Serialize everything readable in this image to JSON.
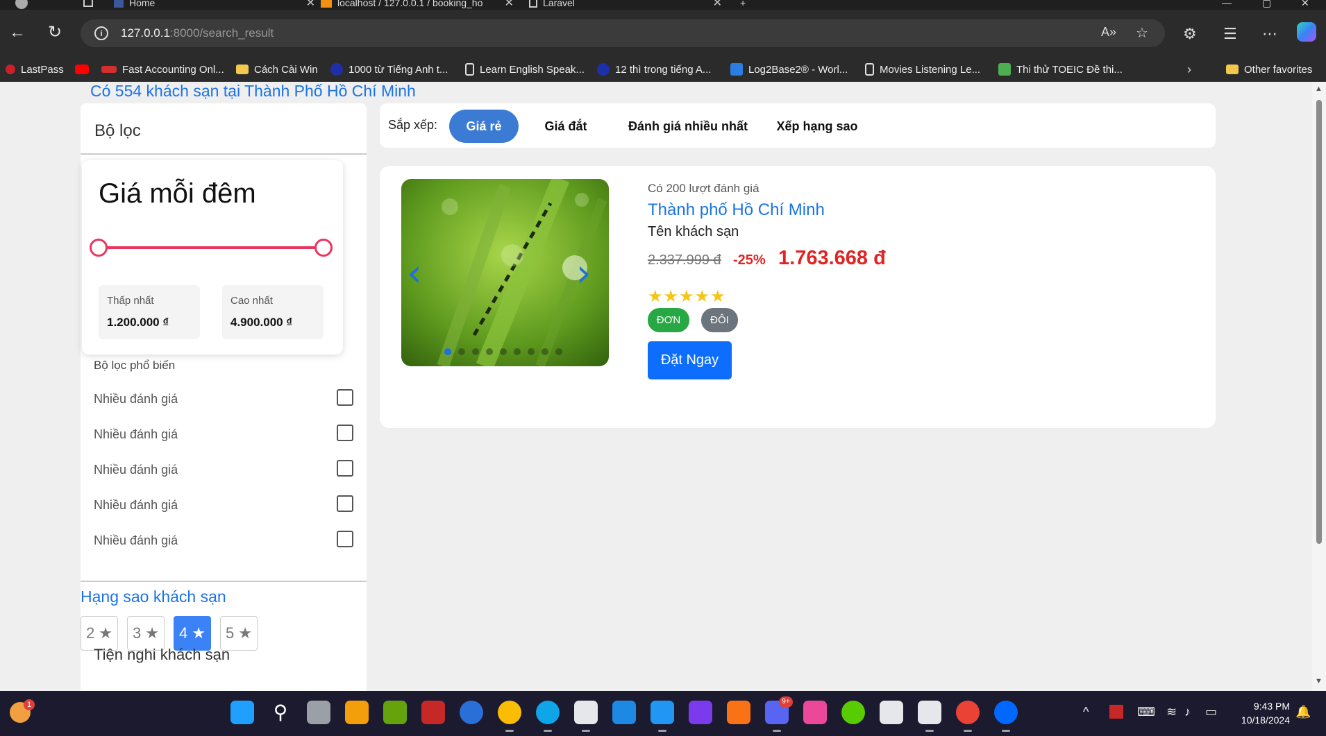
{
  "tabs": [
    {
      "label": "Home"
    },
    {
      "label": "localhost / 127.0.0.1 / booking_ho"
    },
    {
      "label": "Laravel"
    }
  ],
  "browser": {
    "url_host": "127.0.0.1",
    "url_rest": ":8000/search_result"
  },
  "bookmarks": [
    {
      "label": "LastPass",
      "icon": "lastpass-icon",
      "color": "#cc2029"
    },
    {
      "label": "",
      "icon": "youtube-icon",
      "color": "#ff0000"
    },
    {
      "label": "Fast Accounting Onl...",
      "icon": "fast-icon",
      "color": "#d32f2f"
    },
    {
      "label": "Cách Cài Win",
      "icon": "folder-icon",
      "color": "#f2c94c"
    },
    {
      "label": "1000 từ Tiếng Anh t...",
      "icon": "globe-icon",
      "color": "#1e2fa8"
    },
    {
      "label": "Learn English Speak...",
      "icon": "page-icon",
      "color": "#e0e0e0"
    },
    {
      "label": "12 thì trong tiếng A...",
      "icon": "globe-icon",
      "color": "#1e2fa8"
    },
    {
      "label": "Log2Base2® - Worl...",
      "icon": "log2base2-icon",
      "color": "#2a7de1"
    },
    {
      "label": "Movies Listening Le...",
      "icon": "page-icon",
      "color": "#e0e0e0"
    },
    {
      "label": "Thi thử TOEIC Đề thi...",
      "icon": "toeic-icon",
      "color": "#4caf50"
    }
  ],
  "other_favorites": "Other favorites",
  "page": {
    "result_title": "Có 554 khách sạn tại Thành Phố Hồ Chí Minh",
    "filter_title": "Bộ lọc",
    "price": {
      "title": "Giá mỗi đêm",
      "min_label": "Thấp nhất",
      "min_value": "1.200.000 ₫",
      "max_label": "Cao nhất",
      "max_value": "4.900.000 ₫",
      "slider_min_fraction": 0,
      "slider_max_fraction": 1
    },
    "popular_label": "Bộ lọc phổ biến",
    "popular_filters": [
      {
        "label": "Nhiều đánh giá",
        "checked": false
      },
      {
        "label": "Nhiều đánh giá",
        "checked": false
      },
      {
        "label": "Nhiều đánh giá",
        "checked": false
      },
      {
        "label": "Nhiều đánh giá",
        "checked": false
      },
      {
        "label": "Nhiều đánh giá",
        "checked": false
      }
    ],
    "star_title": "Hạng sao khách sạn",
    "star_options": [
      {
        "label": "2 ★",
        "active": false
      },
      {
        "label": "3 ★",
        "active": false
      },
      {
        "label": "4 ★",
        "active": true
      },
      {
        "label": "5 ★",
        "active": false
      }
    ],
    "amenity_title": "Tiện nghi khách sạn",
    "sort": {
      "label": "Sắp xếp:",
      "options": [
        {
          "label": "Giá rẻ",
          "active": true
        },
        {
          "label": "Giá đắt",
          "active": false
        },
        {
          "label": "Đánh giá nhiều nhất",
          "active": false
        },
        {
          "label": "Xếp hạng sao",
          "active": false
        }
      ]
    },
    "hotel": {
      "reviews": "Có 200 lượt đánh giá",
      "city": "Thành phố Hồ Chí Minh",
      "name": "Tên khách sạn",
      "old_price": "2.337.999 đ",
      "discount": "-25%",
      "new_price": "1.763.668 đ",
      "stars": "★★★★★",
      "rating": 5,
      "tags": [
        "ĐƠN",
        "ĐÔI"
      ],
      "book_label": "Đặt Ngay",
      "carousel_slides": 9,
      "carousel_active": 0
    }
  },
  "taskbar": {
    "time": "9:43 PM",
    "date": "10/18/2024",
    "widget_badge": "1",
    "discord_badge": "9+"
  }
}
